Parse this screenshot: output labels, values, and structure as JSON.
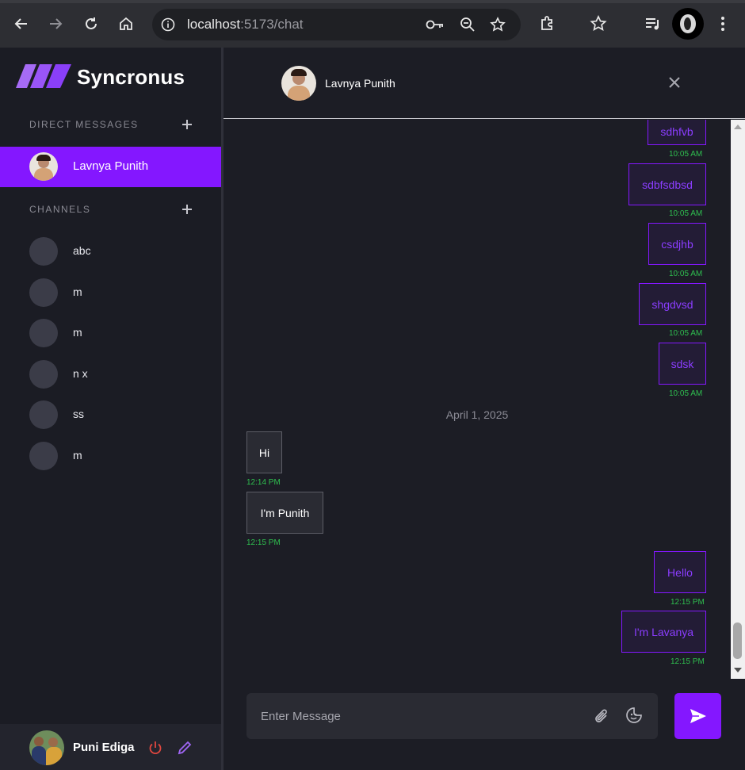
{
  "browser": {
    "url_host": "localhost",
    "url_path": ":5173/chat"
  },
  "sidebar": {
    "app_name": "Syncronus",
    "direct_messages_title": "DIRECT MESSAGES",
    "channels_title": "CHANNELS",
    "direct_messages": [
      {
        "label": "Lavnya Punith"
      }
    ],
    "channels": [
      {
        "label": "abc"
      },
      {
        "label": "m"
      },
      {
        "label": "m"
      },
      {
        "label": "n x"
      },
      {
        "label": "ss"
      },
      {
        "label": "m"
      }
    ],
    "profile": {
      "name": "Puni Ediga"
    }
  },
  "chat": {
    "contact_name": "Lavnya Punith",
    "date_separator": "April 1, 2025",
    "messages": [
      {
        "text": "sdhfvb",
        "time": "10:05 AM",
        "direction": "out"
      },
      {
        "text": "sdbfsdbsd",
        "time": "10:05 AM",
        "direction": "out"
      },
      {
        "text": "csdjhb",
        "time": "10:05 AM",
        "direction": "out"
      },
      {
        "text": "shgdvsd",
        "time": "10:05 AM",
        "direction": "out"
      },
      {
        "text": "sdsk",
        "time": "10:05 AM",
        "direction": "out"
      },
      {
        "text": "Hi",
        "time": "12:14 PM",
        "direction": "in"
      },
      {
        "text": "I'm Punith",
        "time": "12:15 PM",
        "direction": "in"
      },
      {
        "text": "Hello",
        "time": "12:15 PM",
        "direction": "out"
      },
      {
        "text": "I'm Lavanya",
        "time": "12:15 PM",
        "direction": "out"
      }
    ],
    "input_placeholder": "Enter Message"
  },
  "colors": {
    "accent": "#8417ff",
    "time_green": "#2fbf4f",
    "sidebar_bg": "#1b1c24",
    "main_bg": "#1c1d25"
  }
}
